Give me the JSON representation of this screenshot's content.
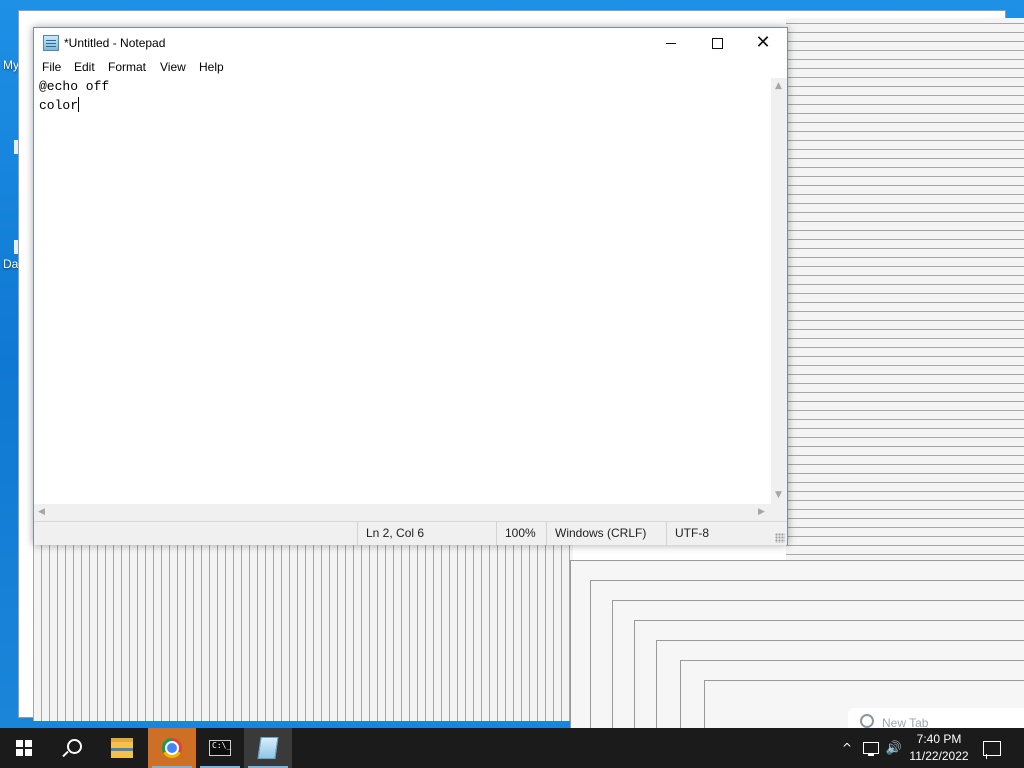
{
  "window": {
    "title": "*Untitled - Notepad",
    "menu": [
      "File",
      "Edit",
      "Format",
      "View",
      "Help"
    ],
    "content_lines": [
      "@echo off",
      "color"
    ],
    "status": {
      "position": "Ln 2, Col 6",
      "zoom": "100%",
      "line_endings": "Windows (CRLF)",
      "encoding": "UTF-8"
    }
  },
  "desktop": {
    "icon_label_1": "My",
    "icon_label_2": "Da",
    "new_tab_hint": "New Tab"
  },
  "taskbar": {
    "items": [
      "start-button",
      "search-icon",
      "file-explorer",
      "google-chrome",
      "command-prompt",
      "notepad"
    ],
    "active_item": "google-chrome",
    "clock_time": "7:40 PM",
    "clock_date": "11/22/2022"
  },
  "colors": {
    "desktop_blue": "#1a84d8",
    "taskbar": "#1b1b1b",
    "active_taskbar_item": "#cf6f25",
    "running_underline": "#77b7e6"
  }
}
